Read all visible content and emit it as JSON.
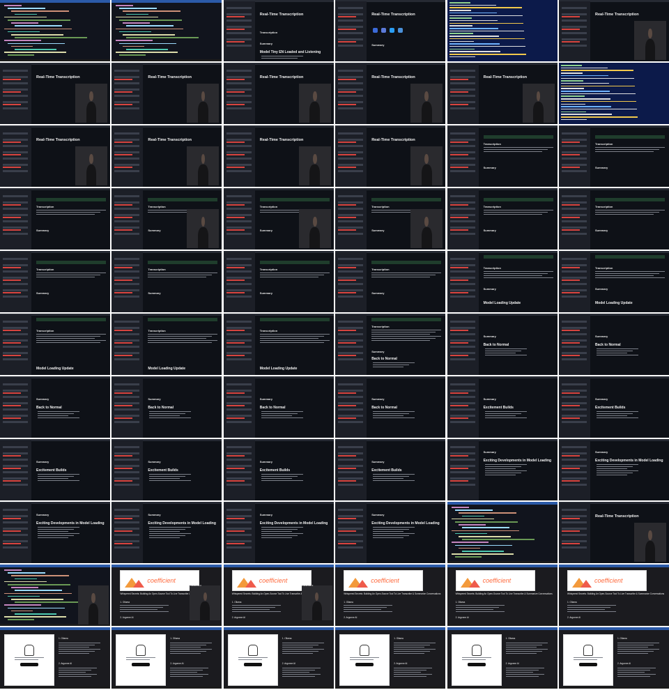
{
  "sheet": {
    "cols": 6,
    "rows": 11
  },
  "app": {
    "title": "Real-Time Transcription",
    "transcription_header": "Transcription",
    "summary_header": "Summary",
    "model_loaded_heading": "Model Tiny EN Loaded and Listening",
    "model_update_heading": "Model Loading Update",
    "back_normal_heading": "Back to Normal",
    "excitement_heading": "Excitement Builds",
    "exciting_dev_heading": "Exciting Developments in Model Loading"
  },
  "blog": {
    "brand": "coefficient",
    "title": "Whispered Secrets: Building An Open-Source Tool To Live Transcribe & Summarize Conversations",
    "step1": "1. Ollama",
    "step2": "2. Argonne AI",
    "overlay_label": "Transcribe it"
  },
  "colors": {
    "bg_dark": "#0e1117",
    "sidebar": "#1c1f27",
    "accent_red": "#d9443f",
    "status_green": "#1f3d2c",
    "terminal_blue": "#0c1a4a",
    "brand_orange": "#ff6a3d"
  },
  "tiles": [
    {
      "kind": "desktop"
    },
    {
      "kind": "desktop"
    },
    {
      "kind": "app",
      "heading": "model_loaded_heading"
    },
    {
      "kind": "app-icons"
    },
    {
      "kind": "terminal"
    },
    {
      "kind": "app-video"
    },
    {
      "kind": "app-video"
    },
    {
      "kind": "app-video"
    },
    {
      "kind": "app-video"
    },
    {
      "kind": "app-video"
    },
    {
      "kind": "app-video"
    },
    {
      "kind": "terminal"
    },
    {
      "kind": "app-video"
    },
    {
      "kind": "app-video"
    },
    {
      "kind": "app-video"
    },
    {
      "kind": "app-video"
    },
    {
      "kind": "app-status"
    },
    {
      "kind": "app-status"
    },
    {
      "kind": "app-status"
    },
    {
      "kind": "app-status-video"
    },
    {
      "kind": "app-status-video"
    },
    {
      "kind": "app-status-video"
    },
    {
      "kind": "app-status"
    },
    {
      "kind": "app-status"
    },
    {
      "kind": "app-status"
    },
    {
      "kind": "app-status"
    },
    {
      "kind": "app-status"
    },
    {
      "kind": "app-status"
    },
    {
      "kind": "app-update"
    },
    {
      "kind": "app-update"
    },
    {
      "kind": "app-update2"
    },
    {
      "kind": "app-update2"
    },
    {
      "kind": "app-update2"
    },
    {
      "kind": "app-text"
    },
    {
      "kind": "app-back"
    },
    {
      "kind": "app-back"
    },
    {
      "kind": "app-back"
    },
    {
      "kind": "app-back"
    },
    {
      "kind": "app-back"
    },
    {
      "kind": "app-back"
    },
    {
      "kind": "app-excite"
    },
    {
      "kind": "app-excite"
    },
    {
      "kind": "app-excite"
    },
    {
      "kind": "app-excite"
    },
    {
      "kind": "app-excite"
    },
    {
      "kind": "app-excite"
    },
    {
      "kind": "app-dev"
    },
    {
      "kind": "app-dev"
    },
    {
      "kind": "app-dev"
    },
    {
      "kind": "app-dev"
    },
    {
      "kind": "app-dev"
    },
    {
      "kind": "app-dev"
    },
    {
      "kind": "ide"
    },
    {
      "kind": "app-video"
    },
    {
      "kind": "ide-video"
    },
    {
      "kind": "blog-video"
    },
    {
      "kind": "blog-video"
    },
    {
      "kind": "blog"
    },
    {
      "kind": "blog2"
    },
    {
      "kind": "blog3"
    },
    {
      "kind": "blog-ollama"
    },
    {
      "kind": "blog-ollama"
    },
    {
      "kind": "blog-ollama"
    },
    {
      "kind": "blog-ollama"
    },
    {
      "kind": "blog-ollama"
    },
    {
      "kind": "blog-ollama"
    }
  ]
}
